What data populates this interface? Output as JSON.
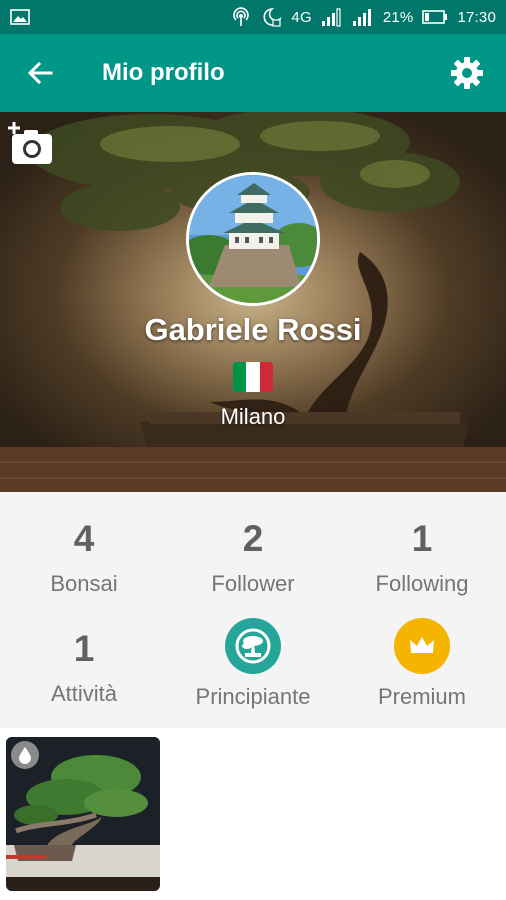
{
  "status_bar": {
    "network": "4G",
    "battery": "21%",
    "time": "17:30"
  },
  "toolbar": {
    "title": "Mio profilo"
  },
  "profile": {
    "name": "Gabriele Rossi",
    "city": "Milano",
    "flag_colors": [
      "#009246",
      "#ffffff",
      "#ce2b37"
    ]
  },
  "stats": [
    {
      "value": "4",
      "label": "Bonsai"
    },
    {
      "value": "2",
      "label": "Follower"
    },
    {
      "value": "1",
      "label": "Following"
    },
    {
      "value": "1",
      "label": "Attività"
    }
  ],
  "badges": [
    {
      "label": "Principiante",
      "icon": "tree-icon",
      "color": "#26a69a"
    },
    {
      "label": "Premium",
      "icon": "crown-icon",
      "color": "#f4b400"
    }
  ],
  "gallery": {
    "items": [
      {
        "icon": "water-drop-icon"
      }
    ]
  },
  "colors": {
    "status_bar": "#00776a",
    "toolbar": "#009788",
    "stats_background": "#f4f4f4"
  }
}
